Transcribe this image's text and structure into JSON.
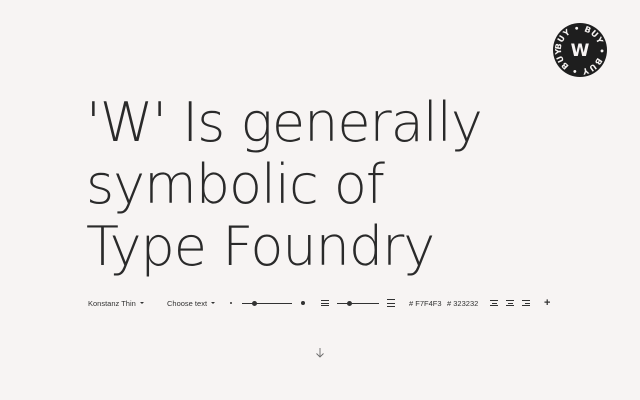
{
  "badge": {
    "letter": "W",
    "ring_text": "BUY • BUY • BUY • BUY •"
  },
  "headline": {
    "lines": [
      "'W' Is generally",
      "symbolic of",
      "Type Foundry"
    ]
  },
  "toolbar": {
    "font_select": "Konstanz Thin",
    "text_select": "Choose text",
    "size_slider_value": 0.25,
    "leading_slider_value": 0.3,
    "bg_color": "# F7F4F3",
    "fg_color": "# 323232"
  },
  "colors": {
    "background": "#F7F4F3",
    "foreground": "#323232"
  },
  "icons": {
    "small_dot": "size-small-icon",
    "large_dot": "size-large-icon",
    "align_left": "align-left-icon",
    "align_center": "align-center-icon",
    "align_right": "align-right-icon",
    "add": "plus-icon",
    "scroll": "arrow-down-icon"
  }
}
